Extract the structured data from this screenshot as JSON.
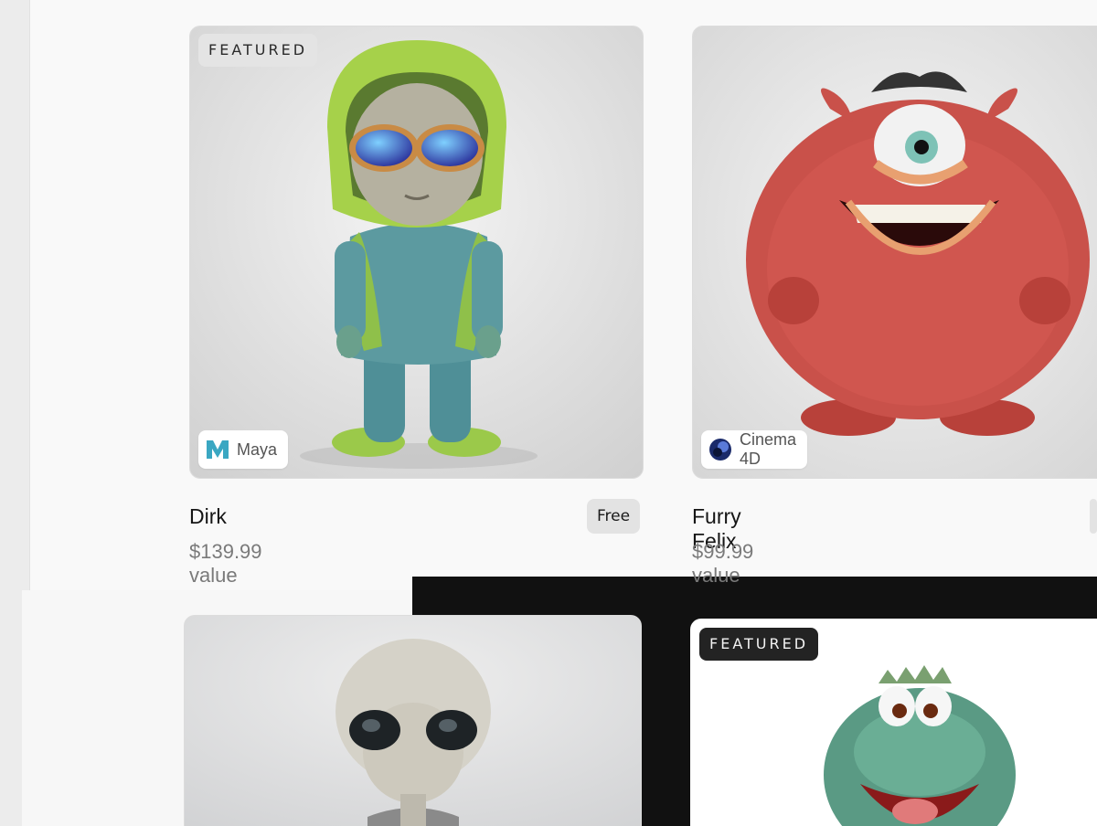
{
  "cards": [
    {
      "badge": "FEATURED",
      "software": "Maya",
      "software_icon": "maya-logo-icon",
      "title": "Dirk",
      "price": "$139.99 value",
      "action": "Free"
    },
    {
      "software": "Cinema 4D",
      "software_icon": "cinema4d-logo-icon",
      "title": "Furry Felix",
      "price": "$99.99 value"
    },
    {
      "title_hidden": true
    },
    {
      "badge": "FEATURED"
    }
  ],
  "colors": {
    "page_bg": "#f9f9f9",
    "dark_panel": "#111111",
    "price_text": "#7a7a7a"
  }
}
